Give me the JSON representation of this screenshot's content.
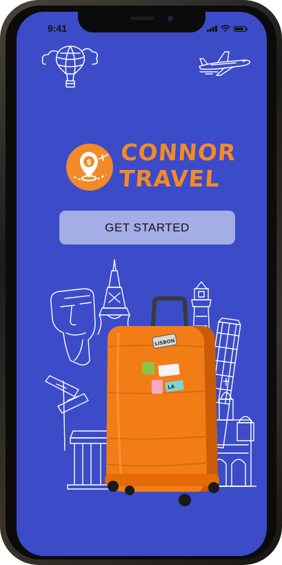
{
  "status_bar": {
    "time": "9:41",
    "battery_fraction": 0.85
  },
  "app": {
    "brand_line_1": "CONNOR",
    "brand_line_2": "TRAVEL",
    "cta_label": "GET STARTED"
  },
  "luggage_stickers": [
    "LISBON",
    "LA"
  ],
  "icons": [
    "hot-air-balloon-icon",
    "airplane-icon",
    "location-pin-icon",
    "suitcase-icon"
  ],
  "colors": {
    "background": "#3c4bc8",
    "accent": "#f28a2a",
    "button": "#a3ade6",
    "suitcase": "#f27d17"
  }
}
